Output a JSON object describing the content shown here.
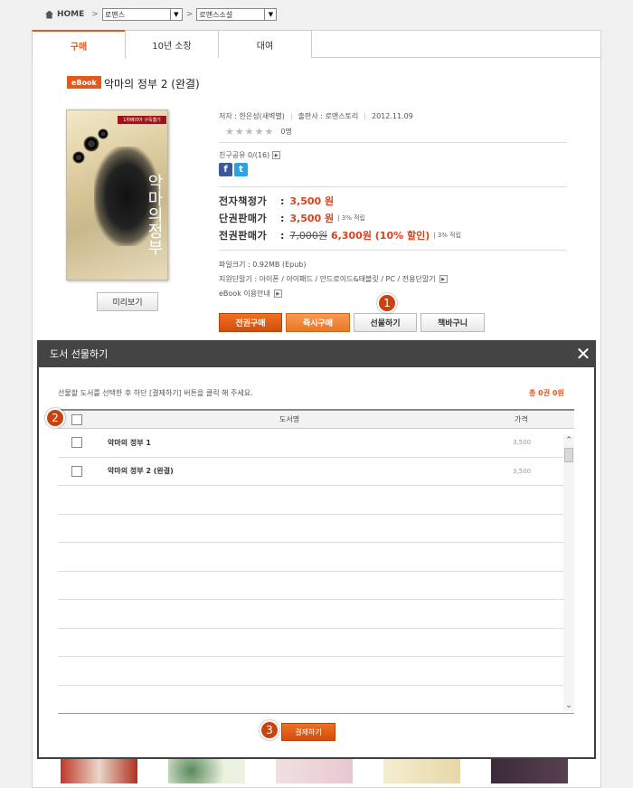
{
  "breadcrumb": {
    "home": "HOME",
    "category1": "로맨스",
    "category2": "로맨스소설"
  },
  "tabs": [
    {
      "label": "구매"
    },
    {
      "label": "10년 소장"
    },
    {
      "label": "대여"
    }
  ],
  "book": {
    "badge": "eBook",
    "title": "악마의 정부 2 (완결)",
    "cover_band": "1위베리아 구독웹기",
    "cover_title": "악마의정부",
    "author": "저자 : 한은성(새벽별)",
    "publisher": "출판사 : 로맨스토리",
    "date": "2012.11.09",
    "rating_count": "0명",
    "share": "친구공유 0/(16)",
    "ebook_price_label": "전자책정가",
    "ebook_price": "3,500 원",
    "single_label": "단권판매가",
    "single_price": "3,500 원",
    "single_point": "3% 적립",
    "full_label": "전권판매가",
    "full_old": "7,000원",
    "full_price": "6,300원 (10% 할인)",
    "full_point": "3% 적립",
    "file_size": "파일크기 : 0.92MB (Epub)",
    "devices": "지원단말기 : 아이폰 / 아이패드 / 안드로이드&태블릿 / PC / 전용단말기",
    "usage": "eBook 이용안내",
    "preview": "미리보기"
  },
  "buttons": {
    "buy_all": "전권구매",
    "buy_now": "즉시구매",
    "gift": "선물하기",
    "cart": "책바구니"
  },
  "steps": {
    "one": "1",
    "two": "2",
    "three": "3"
  },
  "modal": {
    "title": "도서 선물하기",
    "close": "✕",
    "message": "선물할 도서를 선택한 후 하단 [결제하기] 버튼을 클릭 해 주세요.",
    "total": "총 0권 0원",
    "col_name": "도서명",
    "col_price": "가격",
    "rows": [
      {
        "name": "악마의 정부 1",
        "price": "3,500"
      },
      {
        "name": "악마의 정부 2 (완결)",
        "price": "3,500"
      }
    ],
    "pay": "결제하기"
  },
  "colors": {
    "accent": "#e8581d",
    "modal_header": "#444444"
  }
}
